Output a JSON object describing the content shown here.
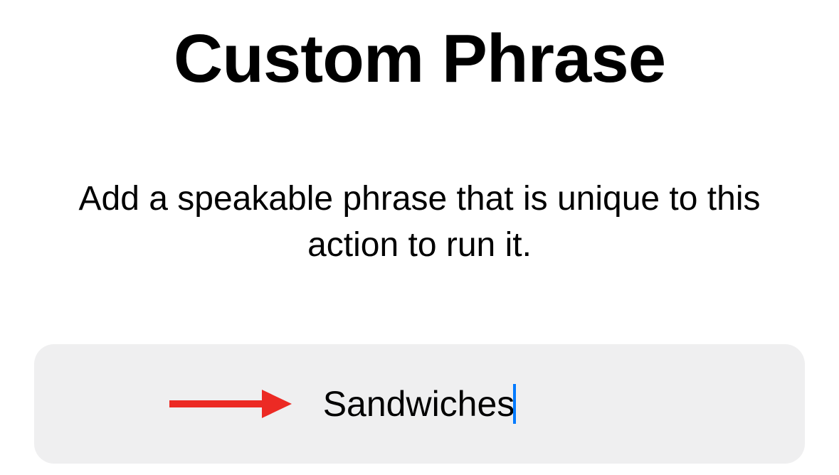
{
  "title": "Custom Phrase",
  "subtitle": "Add a speakable phrase that is unique to this action to run it.",
  "input": {
    "value": "Sandwiches"
  },
  "annotation": {
    "arrow_color": "#ec2a24"
  }
}
